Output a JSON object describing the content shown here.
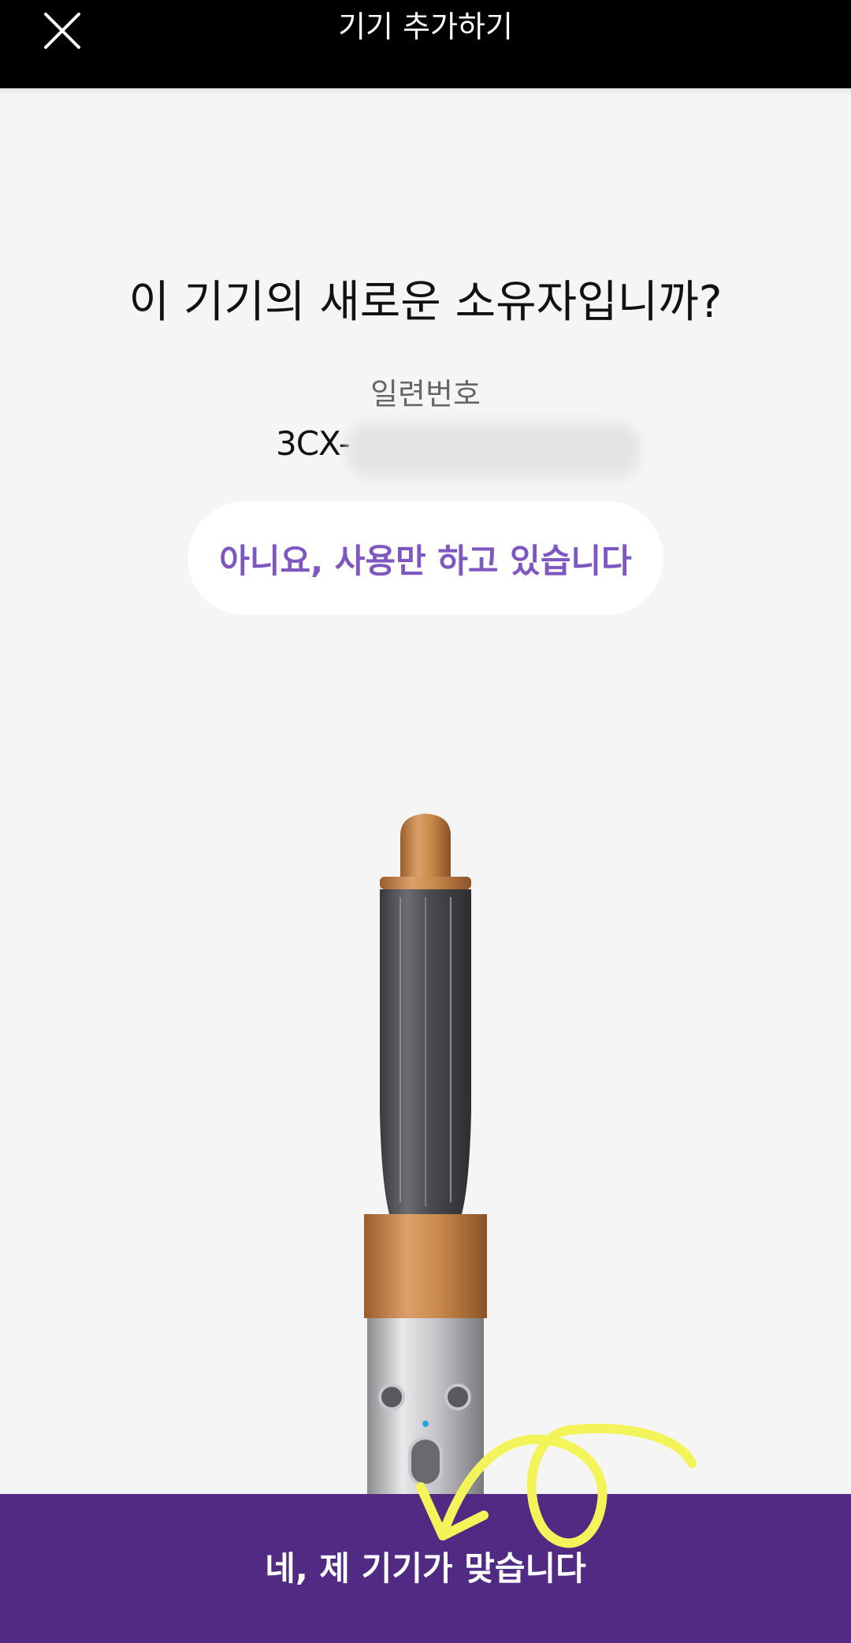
{
  "header": {
    "title": "기기 추가하기",
    "close_icon": "close-icon"
  },
  "main": {
    "question": "이 기기의 새로운 소유자입니까?",
    "serial_label": "일련번호",
    "serial_prefix": "3CX-"
  },
  "buttons": {
    "no_label": "아니요, 사용만 하고 있습니다",
    "yes_label": "네, 제 기기가 맞습니다"
  },
  "colors": {
    "header_bg": "#000000",
    "accent_purple": "#512a84",
    "link_purple": "#7e57c2",
    "copper": "#c98a4b",
    "annotation_yellow": "#f3f35a"
  }
}
